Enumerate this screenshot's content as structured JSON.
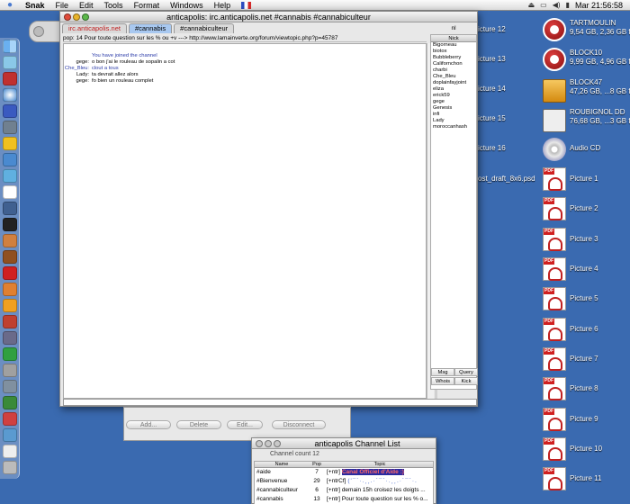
{
  "menubar": {
    "app": "Snak",
    "items": [
      "File",
      "Edit",
      "Tools",
      "Format",
      "Windows",
      "Help"
    ],
    "clock": "Mar 21:56:58",
    "flag_label": "FR"
  },
  "desktop": {
    "volumes": [
      {
        "name": "TARTMOULIN",
        "info": "9,54 GB, 2,36 GB free",
        "kind": "apple"
      },
      {
        "name": "BLOCK10",
        "info": "9,99 GB, 4,96 GB free",
        "kind": "apple"
      },
      {
        "name": "BLOCK47",
        "info": "47,26 GB, ...8 GB free",
        "kind": "hdd"
      },
      {
        "name": "ROUBIGNOL DD",
        "info": "76,68 GB, ...3 GB free",
        "kind": "hdd2"
      },
      {
        "name": "Audio CD",
        "info": "",
        "kind": "cd"
      }
    ],
    "pdfs": [
      "Picture 1",
      "Picture 2",
      "Picture 3",
      "Picture 4",
      "Picture 5",
      "Picture 6",
      "Picture 7",
      "Picture 8",
      "Picture 9",
      "Picture 10",
      "Picture 11"
    ],
    "pdf_tag": "PDF",
    "partial_labels": [
      "icture 12",
      "icture 13",
      "icture 14",
      "icture 15",
      "icture 16",
      "ost_draft_8x6.psd"
    ]
  },
  "irc": {
    "title": "anticapolis: irc.anticapolis.net #cannabis #cannabiculteur",
    "tabs": [
      "irc.anticapolis.net",
      "#cannabis",
      "#cannabiculteur"
    ],
    "topic": "pop: 14 Pour toute question sur les % ou +v ---> http://www.lamainverte.org/forum/viewtopic.php?p=45787",
    "messages": [
      {
        "nick": "",
        "text": "You have joined the channel",
        "blue": true
      },
      {
        "nick": "gege:",
        "text": "o bon j'ai le rouleau de sopalin a cot",
        "blue": false
      },
      {
        "nick": "Che_Bleu:",
        "text": "clout a tous",
        "blue": true
      },
      {
        "nick": "Lady:",
        "text": "ta devrait allez alors",
        "blue": false
      },
      {
        "nick": "gege:",
        "text": "fo bien un rouleau complet",
        "blue": false
      }
    ],
    "nick_header": "nl",
    "nick_column": "Nick",
    "nicks": [
      "Bigorneau",
      "biotox",
      "Bubbleberry",
      "Californchon",
      "charbi",
      "Che_Bleu",
      "doplainfayjoint",
      "eliza",
      "erick59",
      "gege",
      "Genesis",
      "infi",
      "Lady",
      "moroccanhash"
    ],
    "buttons": [
      "Msg",
      "Query",
      "Whois",
      "Kick"
    ]
  },
  "bgwin": {
    "buttons": [
      "Add...",
      "Delete",
      "Edit...",
      "Disconnect"
    ]
  },
  "chanlist": {
    "title": "anticapolis Channel List",
    "count": "Channel count 12",
    "headers": [
      "Name",
      "Pop",
      "Topic"
    ],
    "rows": [
      {
        "name": "#aide",
        "pop": "7",
        "prefix": "[+ntr]",
        "topic": "Canal Officiel d'Aide :)",
        "hl": true
      },
      {
        "name": "#Bienvenue",
        "pop": "29",
        "prefix": "[+ntrCf]",
        "topic": "('¯`·.¸¸.·´¯`·.¸¸.·´¯`·.",
        "hl": false,
        "dots": true
      },
      {
        "name": "#cannabiculteur",
        "pop": "6",
        "prefix": "[+ntr]",
        "topic": "demain 15h croisez les doigts ...",
        "hl": false
      },
      {
        "name": "#cannabis",
        "pop": "13",
        "prefix": "[+ntr]",
        "topic": "Pour toute question sur les % o...",
        "hl": false
      }
    ]
  },
  "colors": {
    "desktop": "#3a6ab0",
    "tab_active": "#a8c8f0",
    "irc_tab": "#c02020",
    "highlight_bg": "#2a2aa0",
    "highlight_fg": "#ff6a6a"
  }
}
